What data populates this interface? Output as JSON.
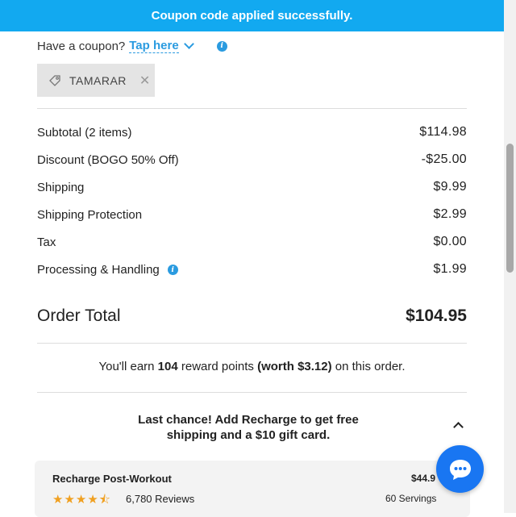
{
  "banner": {
    "text": "Coupon code applied successfully."
  },
  "coupon": {
    "question": "Have a coupon?",
    "tap_label": "Tap here",
    "code": "TAMARAR"
  },
  "summary": {
    "lines": [
      {
        "label": "Subtotal (2 items)",
        "value": "$114.98"
      },
      {
        "label": "Discount (BOGO 50% Off)",
        "value": "-$25.00"
      },
      {
        "label": "Shipping",
        "value": "$9.99"
      },
      {
        "label": "Shipping Protection",
        "value": "$2.99"
      },
      {
        "label": "Tax",
        "value": "$0.00"
      },
      {
        "label": "Processing & Handling",
        "value": "$1.99"
      }
    ],
    "total_label": "Order Total",
    "total_value": "$104.95"
  },
  "reward": {
    "pre": "You'll earn ",
    "points": "104",
    "mid": " reward points ",
    "worth": "(worth $3.12)",
    "post": " on this order."
  },
  "upsell": {
    "line1": "Last chance! Add Recharge to get free",
    "line2": "shipping and a $10 gift card."
  },
  "product": {
    "name": "Recharge Post-Workout",
    "price": "$44.9",
    "rating": 4.5,
    "stars": "★★★★⯪",
    "reviews": "6,780 Reviews",
    "servings": "60 Servings"
  },
  "colors": {
    "banner": "#12a9f0",
    "link": "#2a9be0",
    "chat": "#1976f2",
    "star": "#f0a020"
  }
}
